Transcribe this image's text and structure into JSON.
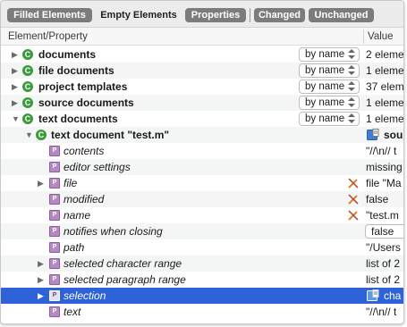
{
  "toolbar": {
    "filled_elements": "Filled Elements",
    "empty_elements": "Empty Elements",
    "properties": "Properties",
    "changed": "Changed",
    "unchanged": "Unchanged"
  },
  "header": {
    "element_property": "Element/Property",
    "value": "Value"
  },
  "rows": [
    {
      "name": "documents",
      "select": "by name",
      "value": "2 eleme"
    },
    {
      "name": "file documents",
      "select": "by name",
      "value": "1 eleme"
    },
    {
      "name": "project templates",
      "select": "by name",
      "value": "37 elem"
    },
    {
      "name": "source documents",
      "select": "by name",
      "value": "1 eleme"
    },
    {
      "name": "text documents",
      "select": "by name",
      "value": "1 eleme"
    },
    {
      "name": "text document \"test.m\"",
      "value": "sou"
    },
    {
      "name": "contents",
      "value": "\"//\\n//  t"
    },
    {
      "name": "editor settings",
      "value": "missing"
    },
    {
      "name": "file",
      "value": "file \"Ma"
    },
    {
      "name": "modified",
      "value": "false"
    },
    {
      "name": "name",
      "value": "\"test.m"
    },
    {
      "name": "notifies when closing",
      "value": "false"
    },
    {
      "name": "path",
      "value": "\"/Users"
    },
    {
      "name": "selected character range",
      "value": "list of 2"
    },
    {
      "name": "selected paragraph range",
      "value": "list of 2"
    },
    {
      "name": "selection",
      "value": "cha"
    },
    {
      "name": "text",
      "value": "\"//\\n//  t"
    }
  ],
  "icons": {
    "class": "class-icon",
    "property": "property-icon",
    "editable": "pencil-crossed-icon",
    "object": "object-specifier-icon",
    "disclosure_collapsed": "disclosure-right-icon",
    "disclosure_expanded": "disclosure-down-icon"
  },
  "colors": {
    "selection": "#2d62d9",
    "toolbar_active": "#7c7c7c",
    "class_icon": "#3b9a3b",
    "property_icon": "#b58ac4"
  }
}
